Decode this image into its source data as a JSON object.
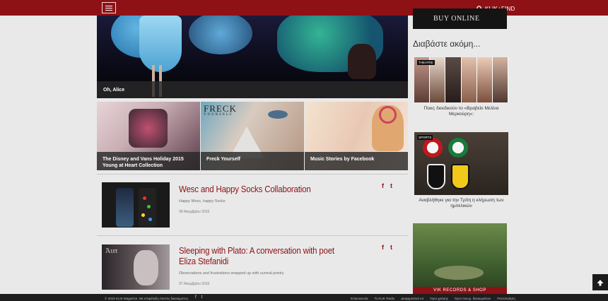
{
  "header": {
    "search_label": "KLIK+FIND"
  },
  "hero": {
    "caption": "Oh, Alice"
  },
  "tiles": [
    {
      "caption": "The Disney and Vans Holiday 2015 Young at Heart Collection"
    },
    {
      "caption": "Freck Yourself",
      "overlay_text": "FRECK",
      "overlay_small": "YOURSELF"
    },
    {
      "caption": "Music Stories by Facebook"
    }
  ],
  "articles": [
    {
      "title": "Wesc and Happy Socks Collaboration",
      "subtitle": "Happy Wesc, happy Socks",
      "date": "09 Νοεμβρίου 2015"
    },
    {
      "title": "Sleeping with Plato: A conversation with poet Eliza Stefanidi",
      "subtitle": "Observations and frustrations wrapped up with surreal poetry",
      "date": "07 Νοεμβρίου 2015",
      "image_text": "Ἀυπ"
    }
  ],
  "social_icons": {
    "facebook": "f",
    "twitter": "t"
  },
  "sidebar": {
    "ad_label": "BUY ONLINE",
    "section_title": "Διαβάστε ακόμη...",
    "items": [
      {
        "tag": "THEATRE",
        "caption": "Ποιες διεκδικούν το «Βραβείο Μελίνα Μερκούρη»;"
      },
      {
        "tag": "SPORTS",
        "caption": "Αναβλήθηκε για την Τρίτη η κλήρωση των ημιτελικών"
      }
    ],
    "ad2_banner": "VIK RECORDS & SHOP"
  },
  "footer": {
    "copyright": "© 2015 KLIK Magazine. Με επιφύλαξη παντός δικαιώματος.",
    "links": [
      "Επικοινωνία",
      "Το KLIK Radio",
      "Διαφημιστικό κιτ",
      "Όροι χρήσης",
      "Όροι πνευμ. δικαιωμάτων",
      "Πιστοποίηση"
    ]
  },
  "colors": {
    "brand": "#8e1116",
    "footer_bg": "#1e1e1e"
  }
}
